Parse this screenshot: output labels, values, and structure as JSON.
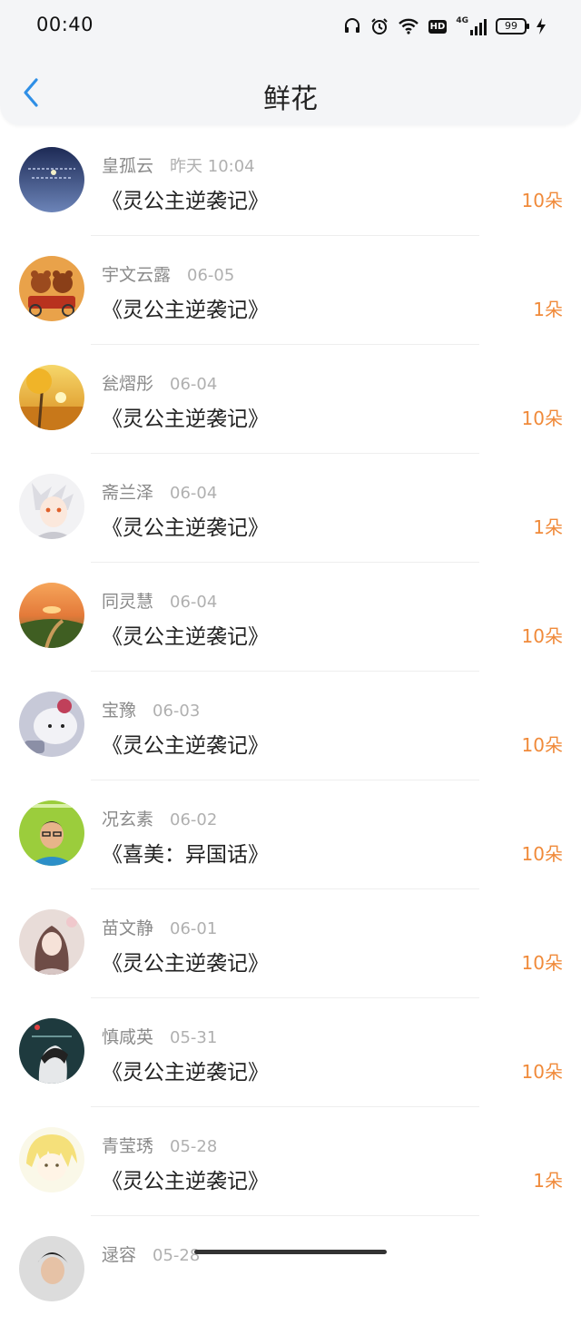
{
  "status_bar": {
    "time": "00:40",
    "network": "4G",
    "hd_label": "HD",
    "battery": "99"
  },
  "header": {
    "title": "鲜花"
  },
  "items": [
    {
      "name": "皇孤云",
      "date": "昨天 10:04",
      "book": "《灵公主逆袭记》",
      "count": "10朵"
    },
    {
      "name": "宇文云露",
      "date": "06-05",
      "book": "《灵公主逆袭记》",
      "count": "1朵"
    },
    {
      "name": "瓮熠彤",
      "date": "06-04",
      "book": "《灵公主逆袭记》",
      "count": "10朵"
    },
    {
      "name": "斋兰泽",
      "date": "06-04",
      "book": "《灵公主逆袭记》",
      "count": "1朵"
    },
    {
      "name": "同灵慧",
      "date": "06-04",
      "book": "《灵公主逆袭记》",
      "count": "10朵"
    },
    {
      "name": "宝豫",
      "date": "06-03",
      "book": "《灵公主逆袭记》",
      "count": "10朵"
    },
    {
      "name": "况玄素",
      "date": "06-02",
      "book": "《喜美：异国话》",
      "count": "10朵"
    },
    {
      "name": "苗文静",
      "date": "06-01",
      "book": "《灵公主逆袭记》",
      "count": "10朵"
    },
    {
      "name": "慎咸英",
      "date": "05-31",
      "book": "《灵公主逆袭记》",
      "count": "10朵"
    },
    {
      "name": "青莹琇",
      "date": "05-28",
      "book": "《灵公主逆袭记》",
      "count": "1朵"
    },
    {
      "name": "逯容",
      "date": "05-28",
      "book": "",
      "count": ""
    }
  ],
  "colors": {
    "accent": "#2f8fe6",
    "flower_count": "#f08a3a"
  }
}
